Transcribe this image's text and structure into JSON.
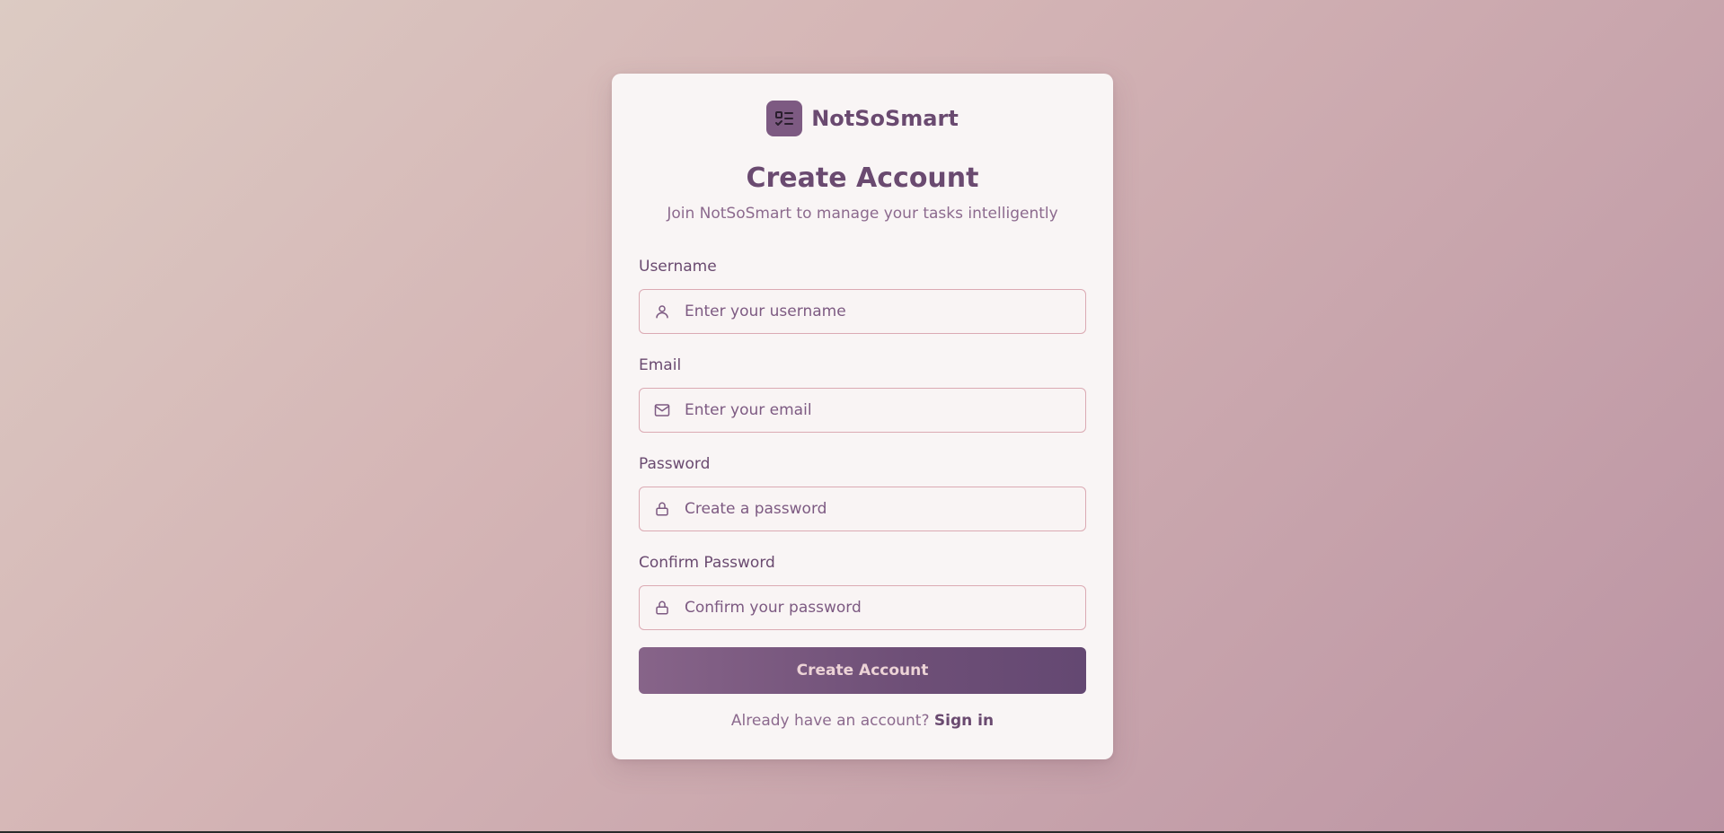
{
  "brand": {
    "name": "NotSoSmart",
    "logo_icon": "checklist-icon"
  },
  "heading": {
    "title": "Create Account",
    "subtitle": "Join NotSoSmart to manage your tasks intelligently"
  },
  "form": {
    "username": {
      "label": "Username",
      "placeholder": "Enter your username",
      "icon": "user-icon"
    },
    "email": {
      "label": "Email",
      "placeholder": "Enter your email",
      "icon": "mail-icon"
    },
    "password": {
      "label": "Password",
      "placeholder": "Create a password",
      "icon": "lock-icon"
    },
    "confirm_password": {
      "label": "Confirm Password",
      "placeholder": "Confirm your password",
      "icon": "lock-icon"
    },
    "submit_label": "Create Account"
  },
  "footer": {
    "prompt": "Already have an account?",
    "link_label": "Sign in"
  },
  "colors": {
    "accent": "#6a4a70",
    "logo_bg": "#7d5a82",
    "input_border": "#dbaab3",
    "card_bg": "#f9f5f5"
  }
}
